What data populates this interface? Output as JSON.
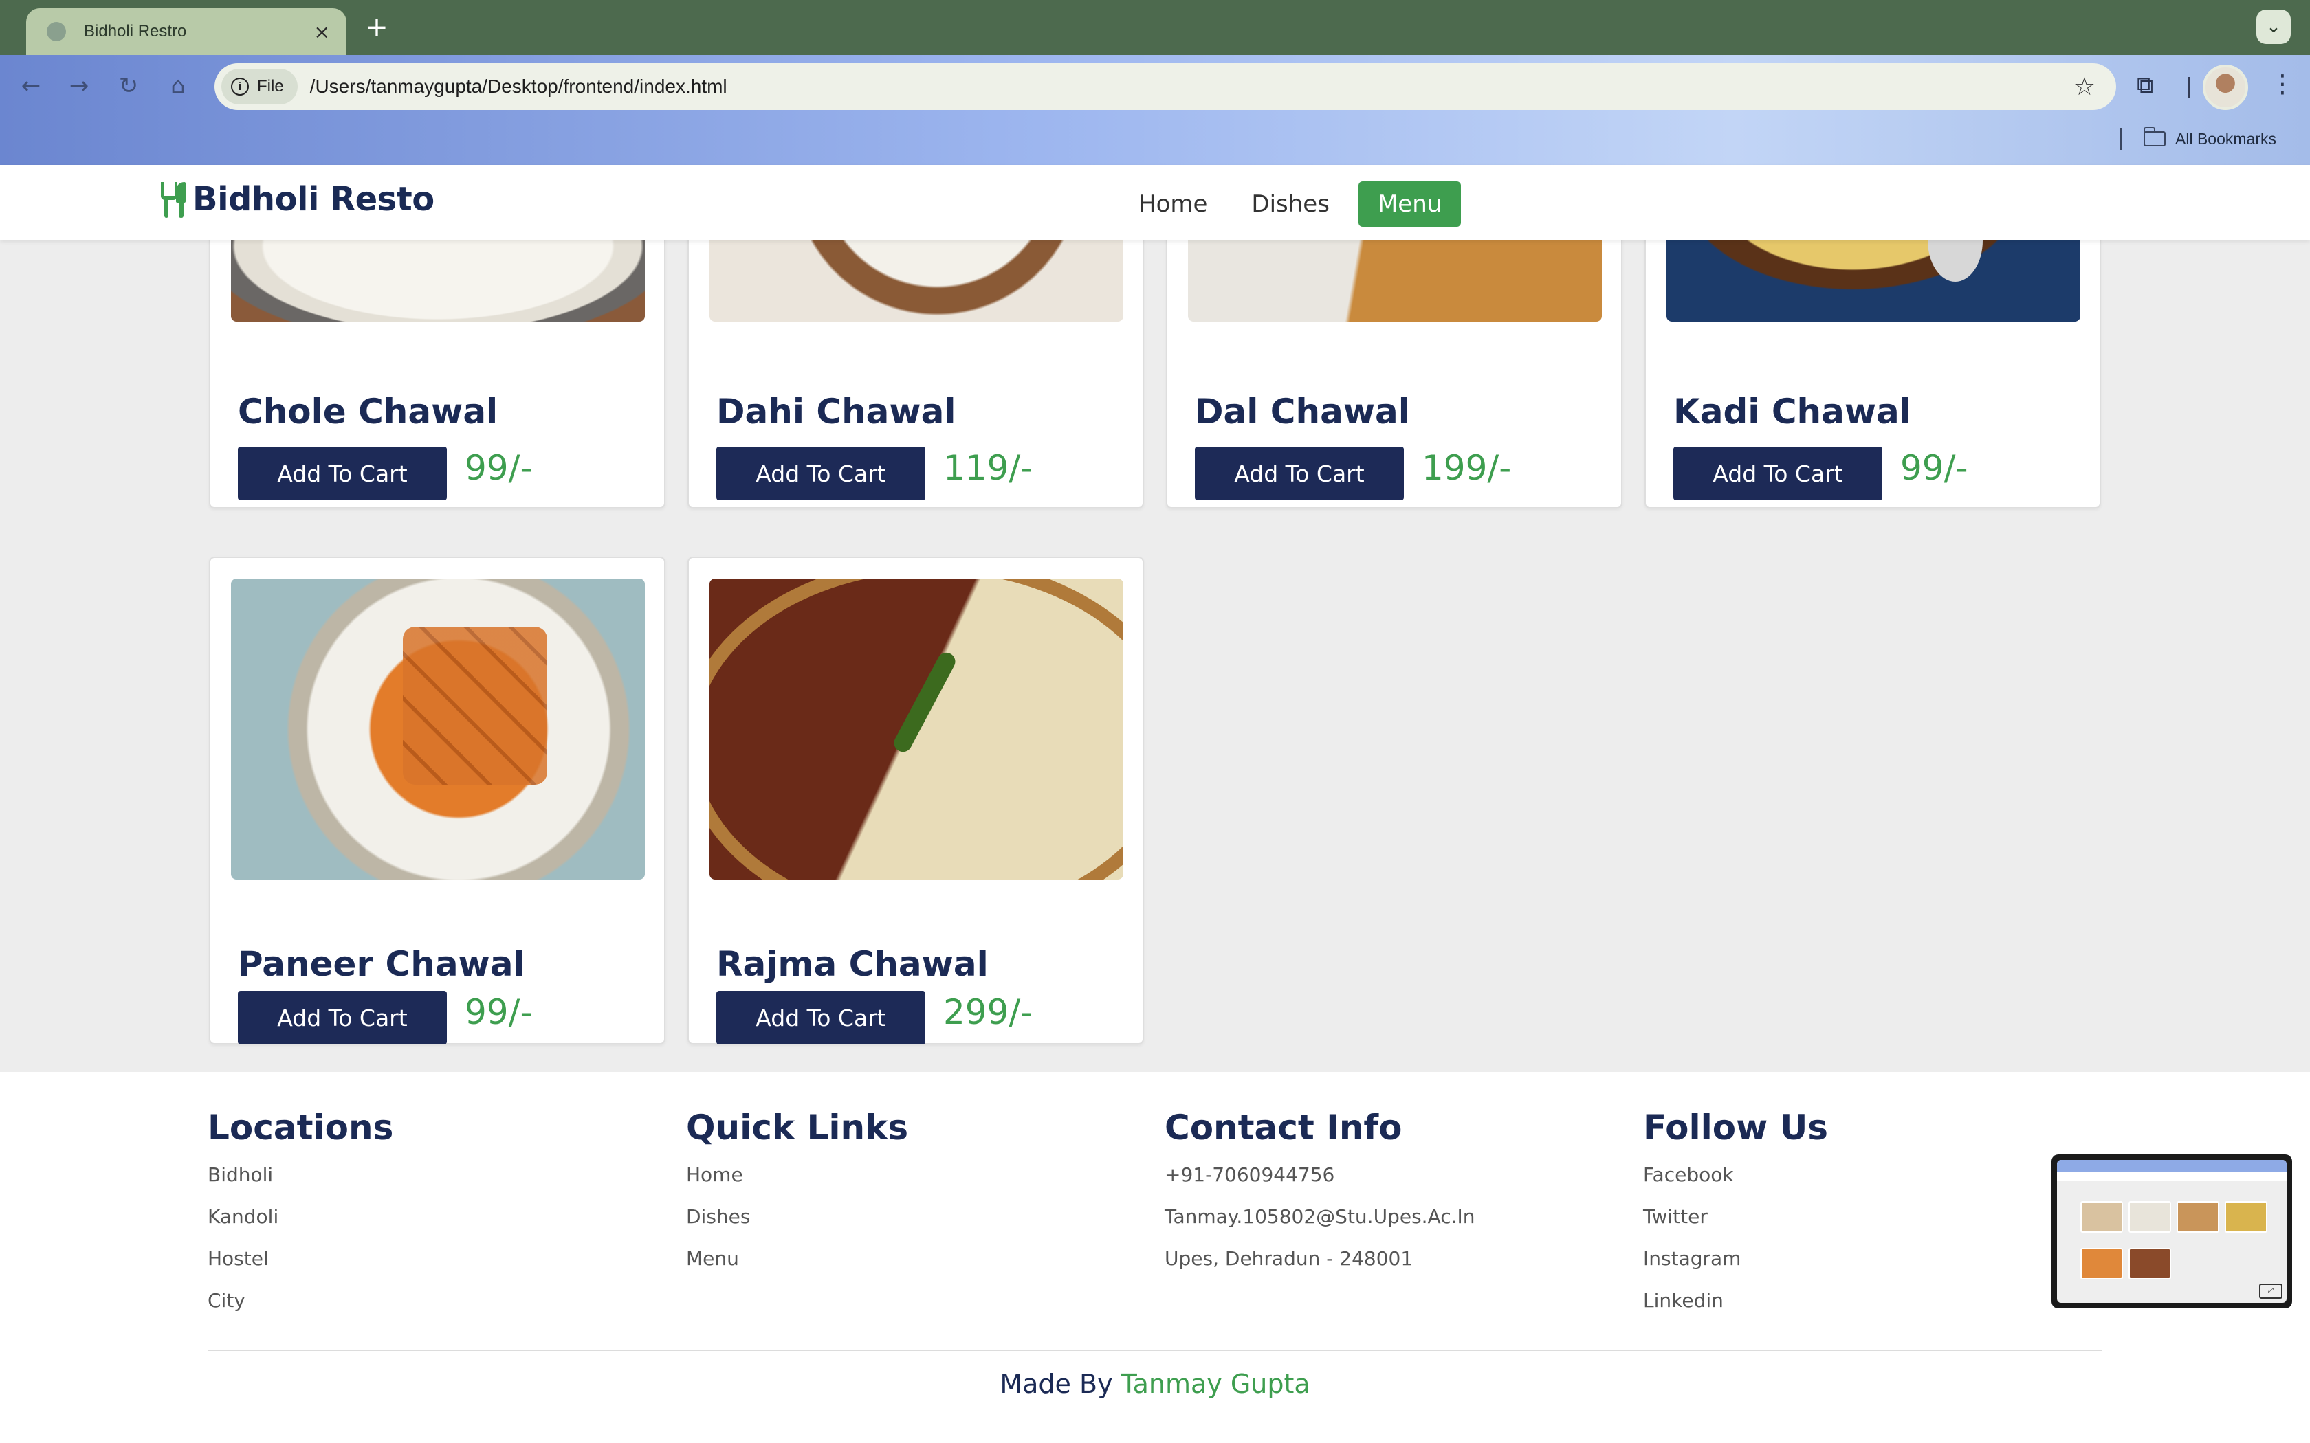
{
  "browser": {
    "tab_title": "Bidholi Restro",
    "tab_close": "×",
    "new_tab": "+",
    "chip_label": "File",
    "url": "/Users/tanmaygupta/Desktop/frontend/index.html",
    "bookmarks_label": "All Bookmarks"
  },
  "header": {
    "brand": "Bidholi Resto",
    "nav": [
      "Home",
      "Dishes",
      "Menu"
    ],
    "active_nav": "Menu"
  },
  "dishes": [
    {
      "name": "Chole Chawal",
      "price": "99/-",
      "button": "Add To Cart",
      "photo": "chole-chawal-photo"
    },
    {
      "name": "Dahi Chawal",
      "price": "119/-",
      "button": "Add To Cart",
      "photo": "dahi-chawal-photo"
    },
    {
      "name": "Dal Chawal",
      "price": "199/-",
      "button": "Add To Cart",
      "photo": "dal-chawal-photo"
    },
    {
      "name": "Kadi Chawal",
      "price": "99/-",
      "button": "Add To Cart",
      "photo": "kadi-chawal-photo"
    },
    {
      "name": "Paneer Chawal",
      "price": "99/-",
      "button": "Add To Cart",
      "photo": "paneer-chawal-photo"
    },
    {
      "name": "Rajma Chawal",
      "price": "299/-",
      "button": "Add To Cart",
      "photo": "rajma-chawal-photo"
    }
  ],
  "footer": {
    "locations": {
      "title": "Locations",
      "items": [
        "Bidholi",
        "Kandoli",
        "Hostel",
        "City"
      ]
    },
    "quick_links": {
      "title": "Quick Links",
      "items": [
        "Home",
        "Dishes",
        "Menu"
      ]
    },
    "contact": {
      "title": "Contact Info",
      "items": [
        "+91-7060944756",
        "Tanmay.105802@Stu.Upes.Ac.In",
        "Upes, Dehradun - 248001"
      ]
    },
    "follow": {
      "title": "Follow Us",
      "items": [
        "Facebook",
        "Twitter",
        "Instagram",
        "Linkedin"
      ]
    },
    "credit_prefix": "Made By",
    "credit_name": "Tanmay Gupta"
  },
  "colors": {
    "brand_navy": "#1b2a55",
    "accent_green": "#3e9e4f",
    "page_bg": "#ededed"
  },
  "icons": [
    "back-arrow-icon",
    "forward-arrow-icon",
    "reload-icon",
    "home-icon",
    "info-icon",
    "star-icon",
    "extensions-icon",
    "kebab-menu-icon",
    "folder-icon",
    "fork-knife-icon"
  ]
}
